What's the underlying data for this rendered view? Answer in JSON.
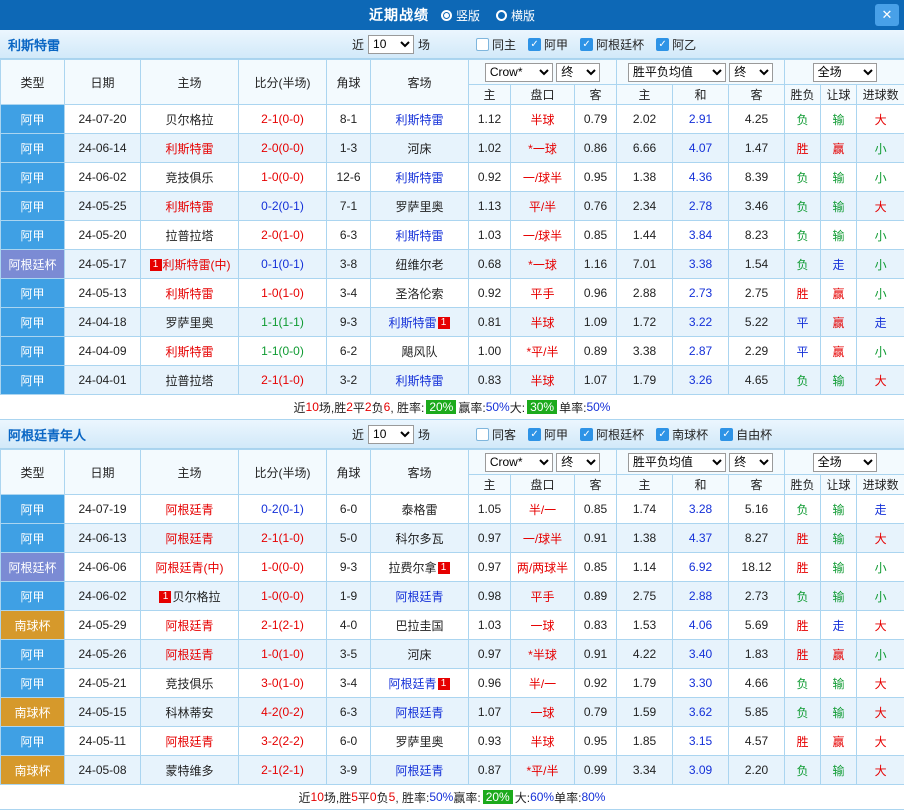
{
  "topbar": {
    "title": "近期战绩",
    "vertical_label": "竖版",
    "horizontal_label": "横版"
  },
  "icons": {
    "check": "✓",
    "close": "✕"
  },
  "badge_glyph": "1",
  "labels": {
    "near": "近",
    "matches": "场"
  },
  "table_controls": {
    "recent_count": "10",
    "company": "Crow*",
    "final": "终",
    "wdl_avg": "胜平负均值",
    "scope": "全场"
  },
  "columns": {
    "type": "类型",
    "date": "日期",
    "home": "主场",
    "score": "比分(半场)",
    "corner": "角球",
    "away": "客场",
    "odds_home": "主",
    "odds_line": "盘口",
    "odds_away": "客",
    "wdl_home": "主",
    "wdl_draw": "和",
    "wdl_away": "客",
    "result": "胜负",
    "handicap": "让球",
    "goals": "进球数"
  },
  "palette": {
    "topbar": "#0d68b6",
    "league": {
      "阿甲": "#3fa0e4",
      "阿根廷杯": "#7b8bd4",
      "南球杯": "#d6992b",
      "阿乙": "#3fa0e4",
      "自由杯": "#3fa0e4"
    },
    "text": {
      "red": "#e60000",
      "blue": "#1430d8",
      "green": "#0f9b32",
      "black": "#222222",
      "white": "#ffffff"
    },
    "maps": {
      "res": {
        "胜": "red",
        "平": "blue",
        "负": "green"
      },
      "hcp": {
        "赢": "red",
        "走": "blue",
        "输": "green"
      },
      "goal": {
        "大": "red",
        "走": "blue",
        "小": "green"
      }
    },
    "badge_bg": "#1caa1c",
    "checkbox_on": "#2e93e6"
  },
  "sections": [
    {
      "title": "利斯特雷",
      "filters": [
        {
          "label": "同主",
          "checked": false
        },
        {
          "label": "阿甲",
          "checked": true
        },
        {
          "label": "阿根廷杯",
          "checked": true
        },
        {
          "label": "阿乙",
          "checked": true
        }
      ],
      "rows": [
        {
          "league": "阿甲",
          "date": "24-07-20",
          "home": "贝尔格拉",
          "home_c": "black",
          "score": "2-1(0-0)",
          "score_c": "red",
          "corner": "8-1",
          "away": "利斯特雷",
          "away_c": "blue",
          "o1": "1.12",
          "line": "半球",
          "o2": "0.79",
          "w1": "2.02",
          "w2": "2.91",
          "w3": "4.25",
          "res": "负",
          "hcp": "输",
          "goal": "大"
        },
        {
          "league": "阿甲",
          "date": "24-06-14",
          "home": "利斯特雷",
          "home_c": "red",
          "score": "2-0(0-0)",
          "score_c": "red",
          "corner": "1-3",
          "away": "河床",
          "away_c": "black",
          "o1": "1.02",
          "line": "*一球",
          "o2": "0.86",
          "w1": "6.66",
          "w2": "4.07",
          "w3": "1.47",
          "res": "胜",
          "hcp": "赢",
          "goal": "小"
        },
        {
          "league": "阿甲",
          "date": "24-06-02",
          "home": "竞技俱乐",
          "home_c": "black",
          "score": "1-0(0-0)",
          "score_c": "red",
          "corner": "12-6",
          "away": "利斯特雷",
          "away_c": "blue",
          "o1": "0.92",
          "line": "一/球半",
          "o2": "0.95",
          "w1": "1.38",
          "w2": "4.36",
          "w3": "8.39",
          "res": "负",
          "hcp": "输",
          "goal": "小"
        },
        {
          "league": "阿甲",
          "date": "24-05-25",
          "home": "利斯特雷",
          "home_c": "red",
          "score": "0-2(0-1)",
          "score_c": "blue",
          "corner": "7-1",
          "away": "罗萨里奥",
          "away_c": "black",
          "o1": "1.13",
          "line": "平/半",
          "o2": "0.76",
          "w1": "2.34",
          "w2": "2.78",
          "w3": "3.46",
          "res": "负",
          "hcp": "输",
          "goal": "大"
        },
        {
          "league": "阿甲",
          "date": "24-05-20",
          "home": "拉普拉塔",
          "home_c": "black",
          "score": "2-0(1-0)",
          "score_c": "red",
          "corner": "6-3",
          "away": "利斯特雷",
          "away_c": "blue",
          "o1": "1.03",
          "line": "一/球半",
          "o2": "0.85",
          "w1": "1.44",
          "w2": "3.84",
          "w3": "8.23",
          "res": "负",
          "hcp": "输",
          "goal": "小"
        },
        {
          "league": "阿根廷杯",
          "date": "24-05-17",
          "home": "利斯特雷(中)",
          "home_c": "red",
          "home_badge": "pre",
          "score": "0-1(0-1)",
          "score_c": "blue",
          "corner": "3-8",
          "away": "纽维尔老",
          "away_c": "black",
          "o1": "0.68",
          "line": "*一球",
          "o2": "1.16",
          "w1": "7.01",
          "w2": "3.38",
          "w3": "1.54",
          "res": "负",
          "hcp": "走",
          "goal": "小"
        },
        {
          "league": "阿甲",
          "date": "24-05-13",
          "home": "利斯特雷",
          "home_c": "red",
          "score": "1-0(1-0)",
          "score_c": "red",
          "corner": "3-4",
          "away": "圣洛伦索",
          "away_c": "black",
          "o1": "0.92",
          "line": "平手",
          "o2": "0.96",
          "w1": "2.88",
          "w2": "2.73",
          "w3": "2.75",
          "res": "胜",
          "hcp": "赢",
          "goal": "小"
        },
        {
          "league": "阿甲",
          "date": "24-04-18",
          "home": "罗萨里奥",
          "home_c": "black",
          "score": "1-1(1-1)",
          "score_c": "green",
          "corner": "9-3",
          "away": "利斯特雷",
          "away_c": "blue",
          "away_badge": "post",
          "o1": "0.81",
          "line": "半球",
          "o2": "1.09",
          "w1": "1.72",
          "w2": "3.22",
          "w3": "5.22",
          "res": "平",
          "hcp": "赢",
          "goal": "走"
        },
        {
          "league": "阿甲",
          "date": "24-04-09",
          "home": "利斯特雷",
          "home_c": "red",
          "score": "1-1(0-0)",
          "score_c": "green",
          "corner": "6-2",
          "away": "飓风队",
          "away_c": "black",
          "o1": "1.00",
          "line": "*平/半",
          "o2": "0.89",
          "w1": "3.38",
          "w2": "2.87",
          "w3": "2.29",
          "res": "平",
          "hcp": "赢",
          "goal": "小"
        },
        {
          "league": "阿甲",
          "date": "24-04-01",
          "home": "拉普拉塔",
          "home_c": "black",
          "score": "2-1(1-0)",
          "score_c": "red",
          "corner": "3-2",
          "away": "利斯特雷",
          "away_c": "blue",
          "o1": "0.83",
          "line": "半球",
          "o2": "1.07",
          "w1": "1.79",
          "w2": "3.26",
          "w3": "4.65",
          "res": "负",
          "hcp": "输",
          "goal": "大"
        }
      ],
      "footer": [
        {
          "t": "近"
        },
        {
          "t": "10",
          "c": "red"
        },
        {
          "t": "场,胜"
        },
        {
          "t": "2",
          "c": "red"
        },
        {
          "t": "平"
        },
        {
          "t": "2",
          "c": "red"
        },
        {
          "t": "负"
        },
        {
          "t": "6",
          "c": "red"
        },
        {
          "t": ", 胜率: "
        },
        {
          "t": "20%",
          "badge": true
        },
        {
          "t": " 赢率:"
        },
        {
          "t": "50%",
          "c": "blue"
        },
        {
          "t": " 大: "
        },
        {
          "t": "30%",
          "badge": true
        },
        {
          "t": " 单率:"
        },
        {
          "t": "50%",
          "c": "blue"
        }
      ]
    },
    {
      "title": "阿根廷青年人",
      "filters": [
        {
          "label": "同客",
          "checked": false
        },
        {
          "label": "阿甲",
          "checked": true
        },
        {
          "label": "阿根廷杯",
          "checked": true
        },
        {
          "label": "南球杯",
          "checked": true
        },
        {
          "label": "自由杯",
          "checked": true
        }
      ],
      "rows": [
        {
          "league": "阿甲",
          "date": "24-07-19",
          "home": "阿根廷青",
          "home_c": "red",
          "score": "0-2(0-1)",
          "score_c": "blue",
          "corner": "6-0",
          "away": "泰格雷",
          "away_c": "black",
          "o1": "1.05",
          "line": "半/一",
          "o2": "0.85",
          "w1": "1.74",
          "w2": "3.28",
          "w3": "5.16",
          "res": "负",
          "hcp": "输",
          "goal": "走"
        },
        {
          "league": "阿甲",
          "date": "24-06-13",
          "home": "阿根廷青",
          "home_c": "red",
          "score": "2-1(1-0)",
          "score_c": "red",
          "corner": "5-0",
          "away": "科尔多瓦",
          "away_c": "black",
          "o1": "0.97",
          "line": "一/球半",
          "o2": "0.91",
          "w1": "1.38",
          "w2": "4.37",
          "w3": "8.27",
          "res": "胜",
          "hcp": "输",
          "goal": "大"
        },
        {
          "league": "阿根廷杯",
          "date": "24-06-06",
          "home": "阿根廷青(中)",
          "home_c": "red",
          "score": "1-0(0-0)",
          "score_c": "red",
          "corner": "9-3",
          "away": "拉费尔拿",
          "away_c": "black",
          "away_badge": "post",
          "o1": "0.97",
          "line": "两/两球半",
          "o2": "0.85",
          "w1": "1.14",
          "w2": "6.92",
          "w3": "18.12",
          "res": "胜",
          "hcp": "输",
          "goal": "小"
        },
        {
          "league": "阿甲",
          "date": "24-06-02",
          "home": "贝尔格拉",
          "home_c": "black",
          "home_badge": "pre",
          "score": "1-0(0-0)",
          "score_c": "red",
          "corner": "1-9",
          "away": "阿根廷青",
          "away_c": "blue",
          "o1": "0.98",
          "line": "平手",
          "o2": "0.89",
          "w1": "2.75",
          "w2": "2.88",
          "w3": "2.73",
          "res": "负",
          "hcp": "输",
          "goal": "小"
        },
        {
          "league": "南球杯",
          "date": "24-05-29",
          "home": "阿根廷青",
          "home_c": "red",
          "score": "2-1(2-1)",
          "score_c": "red",
          "corner": "4-0",
          "away": "巴拉圭国",
          "away_c": "black",
          "o1": "1.03",
          "line": "一球",
          "o2": "0.83",
          "w1": "1.53",
          "w2": "4.06",
          "w3": "5.69",
          "res": "胜",
          "hcp": "走",
          "goal": "大"
        },
        {
          "league": "阿甲",
          "date": "24-05-26",
          "home": "阿根廷青",
          "home_c": "red",
          "score": "1-0(1-0)",
          "score_c": "red",
          "corner": "3-5",
          "away": "河床",
          "away_c": "black",
          "o1": "0.97",
          "line": "*半球",
          "o2": "0.91",
          "w1": "4.22",
          "w2": "3.40",
          "w3": "1.83",
          "res": "胜",
          "hcp": "赢",
          "goal": "小"
        },
        {
          "league": "阿甲",
          "date": "24-05-21",
          "home": "竞技俱乐",
          "home_c": "black",
          "score": "3-0(1-0)",
          "score_c": "red",
          "corner": "3-4",
          "away": "阿根廷青",
          "away_c": "blue",
          "away_badge": "post",
          "o1": "0.96",
          "line": "半/一",
          "o2": "0.92",
          "w1": "1.79",
          "w2": "3.30",
          "w3": "4.66",
          "res": "负",
          "hcp": "输",
          "goal": "大"
        },
        {
          "league": "南球杯",
          "date": "24-05-15",
          "home": "科林蒂安",
          "home_c": "black",
          "score": "4-2(0-2)",
          "score_c": "red",
          "corner": "6-3",
          "away": "阿根廷青",
          "away_c": "blue",
          "o1": "1.07",
          "line": "一球",
          "o2": "0.79",
          "w1": "1.59",
          "w2": "3.62",
          "w3": "5.85",
          "res": "负",
          "hcp": "输",
          "goal": "大"
        },
        {
          "league": "阿甲",
          "date": "24-05-11",
          "home": "阿根廷青",
          "home_c": "red",
          "score": "3-2(2-2)",
          "score_c": "red",
          "corner": "6-0",
          "away": "罗萨里奥",
          "away_c": "black",
          "o1": "0.93",
          "line": "半球",
          "o2": "0.95",
          "w1": "1.85",
          "w2": "3.15",
          "w3": "4.57",
          "res": "胜",
          "hcp": "赢",
          "goal": "大"
        },
        {
          "league": "南球杯",
          "date": "24-05-08",
          "home": "蒙特维多",
          "home_c": "black",
          "score": "2-1(2-1)",
          "score_c": "red",
          "corner": "3-9",
          "away": "阿根廷青",
          "away_c": "blue",
          "o1": "0.87",
          "line": "*平/半",
          "o2": "0.99",
          "w1": "3.34",
          "w2": "3.09",
          "w3": "2.20",
          "res": "负",
          "hcp": "输",
          "goal": "大"
        }
      ],
      "footer": [
        {
          "t": "近"
        },
        {
          "t": "10",
          "c": "red"
        },
        {
          "t": "场,胜"
        },
        {
          "t": "5",
          "c": "red"
        },
        {
          "t": "平"
        },
        {
          "t": "0",
          "c": "red"
        },
        {
          "t": "负"
        },
        {
          "t": "5",
          "c": "red"
        },
        {
          "t": ", 胜率:"
        },
        {
          "t": "50%",
          "c": "blue"
        },
        {
          "t": " 赢率: "
        },
        {
          "t": "20%",
          "badge": true
        },
        {
          "t": " 大:"
        },
        {
          "t": "60%",
          "c": "blue"
        },
        {
          "t": " 单率:"
        },
        {
          "t": "80%",
          "c": "blue"
        }
      ]
    }
  ]
}
